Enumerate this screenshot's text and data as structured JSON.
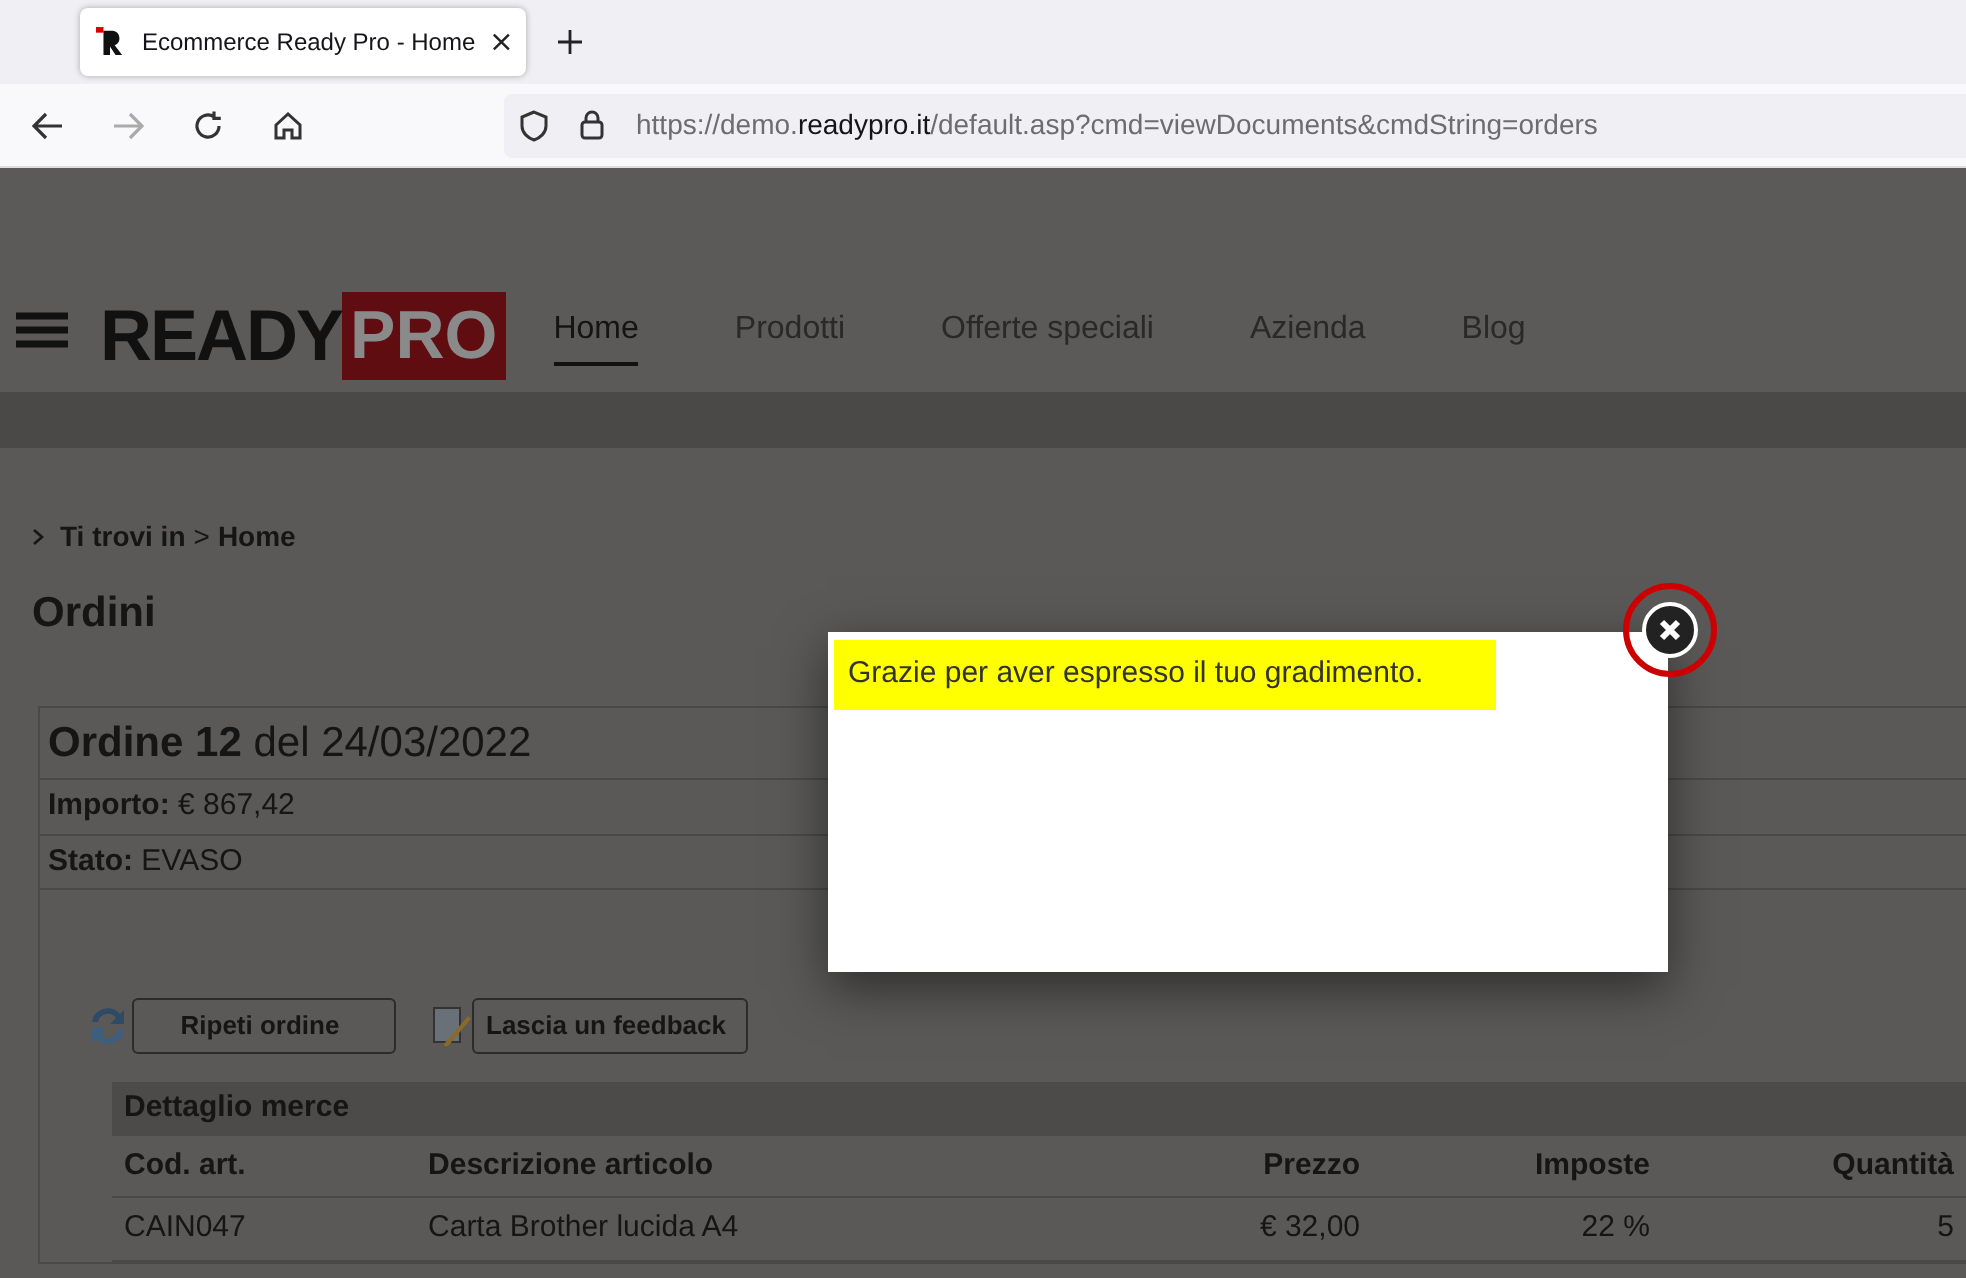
{
  "browser": {
    "tab": {
      "title": "Ecommerce Ready Pro - Home"
    },
    "url_parts": [
      {
        "text": "https://demo.",
        "kind": "dim"
      },
      {
        "text": "readypro.it",
        "kind": "strong"
      },
      {
        "text": "/default.asp?cmd=viewDocuments&cmdString=orders",
        "kind": "dim"
      }
    ]
  },
  "header": {
    "logo": {
      "word": "READY",
      "accent": "PRO"
    },
    "nav": [
      {
        "label": "Home",
        "selected": true
      },
      {
        "label": "Prodotti",
        "selected": false
      },
      {
        "label": "Offerte speciali",
        "selected": false
      },
      {
        "label": "Azienda",
        "selected": false
      },
      {
        "label": "Blog",
        "selected": false
      }
    ]
  },
  "breadcrumb": {
    "label": "Ti trovi in",
    "separator": ">",
    "current": "Home"
  },
  "page_title": "Ordini",
  "order": {
    "title": "**Ordine 12** del 24/03/2022",
    "fields": [
      {
        "label": "Importo:",
        "value": "€ 867,42"
      },
      {
        "label": "Stato:",
        "value": "EVASO"
      }
    ],
    "buttons": [
      {
        "label": "Ripeti ordine",
        "kind": "repeat"
      },
      {
        "label": "Lascia un feedback",
        "kind": "feedback"
      }
    ],
    "detail": {
      "title": "Dettaglio merce",
      "columns": [
        "Cod. art.",
        "Descrizione articolo",
        "Prezzo",
        "Imposte",
        "Quantità"
      ],
      "rows": [
        [
          "CAIN047",
          "Carta Brother lucida A4",
          "€ 32,00",
          "22 %",
          "5"
        ]
      ]
    }
  },
  "modal": {
    "message": "Grazie per aver espresso il tuo gradimento."
  }
}
